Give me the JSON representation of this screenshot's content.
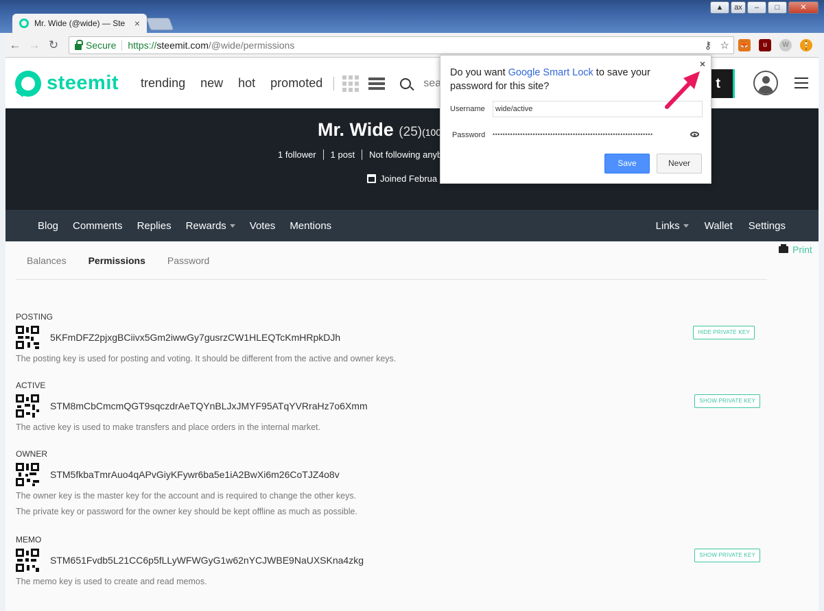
{
  "browser": {
    "tab_title": "Mr. Wide (@wide) — Ste",
    "secure_label": "Secure",
    "url_scheme": "https://",
    "url_host": "steemit.com",
    "url_path": "/@wide/permissions",
    "window_user": "ax"
  },
  "header": {
    "logo_text": "steemit",
    "nav": [
      "trending",
      "new",
      "hot",
      "promoted"
    ],
    "search_placeholder": "search",
    "post_label": "t"
  },
  "profile": {
    "name": "Mr. Wide",
    "reputation": "(25)",
    "rep_extra": "(100",
    "stats": [
      "1 follower",
      "1 post",
      "Not following anyb"
    ],
    "joined": "Joined Februa"
  },
  "subnav": {
    "left": [
      "Blog",
      "Comments",
      "Replies",
      "Rewards",
      "Votes",
      "Mentions"
    ],
    "right": [
      "Links",
      "Wallet",
      "Settings"
    ]
  },
  "wallet": {
    "print_label": "Print",
    "tabs": [
      "Balances",
      "Permissions",
      "Password"
    ],
    "keys": [
      {
        "title": "POSTING",
        "value": "5KFmDFZ2pjxgBCiivx5Gm2iwwGy7gusrzCW1HLEQTcKmHRpkDJh",
        "button": "HIDE PRIVATE KEY",
        "desc": [
          "The posting key is used for posting and voting. It should be different from the active and owner keys."
        ]
      },
      {
        "title": "ACTIVE",
        "value": "STM8mCbCmcmQGT9sqczdrAeTQYnBLJxJMYF95ATqYVRraHz7o6Xmm",
        "button": "SHOW PRIVATE KEY",
        "desc": [
          "The active key is used to make transfers and place orders in the internal market."
        ]
      },
      {
        "title": "OWNER",
        "value": "STM5fkbaTmrAuo4qAPvGiyKFywr6ba5e1iA2BwXi6m26CoTJZ4o8v",
        "button": "",
        "desc": [
          "The owner key is the master key for the account and is required to change the other keys.",
          "The private key or password for the owner key should be kept offline as much as possible."
        ]
      },
      {
        "title": "MEMO",
        "value": "STM651Fvdb5L21CC6p5fLLyWFWGyG1w62nYCJWBE9NaUXSKna4zkg",
        "button": "SHOW PRIVATE KEY",
        "desc": [
          "The memo key is used to create and read memos."
        ]
      }
    ]
  },
  "popup": {
    "question_pre": "Do you want ",
    "question_link": "Google Smart Lock",
    "question_post": " to save your password for this site?",
    "username_label": "Username",
    "username_value": "wide/active",
    "password_label": "Password",
    "password_mask": "••••••••••••••••••••••••••••••••••••••••••••••••••••••••••••••••",
    "save_label": "Save",
    "never_label": "Never",
    "close_glyph": "×"
  },
  "colors": {
    "brand": "#06d6a9",
    "link": "#3ec5a0",
    "banner": "#1c2127",
    "subnav": "#2c3742",
    "arrow": "#e8185c"
  }
}
